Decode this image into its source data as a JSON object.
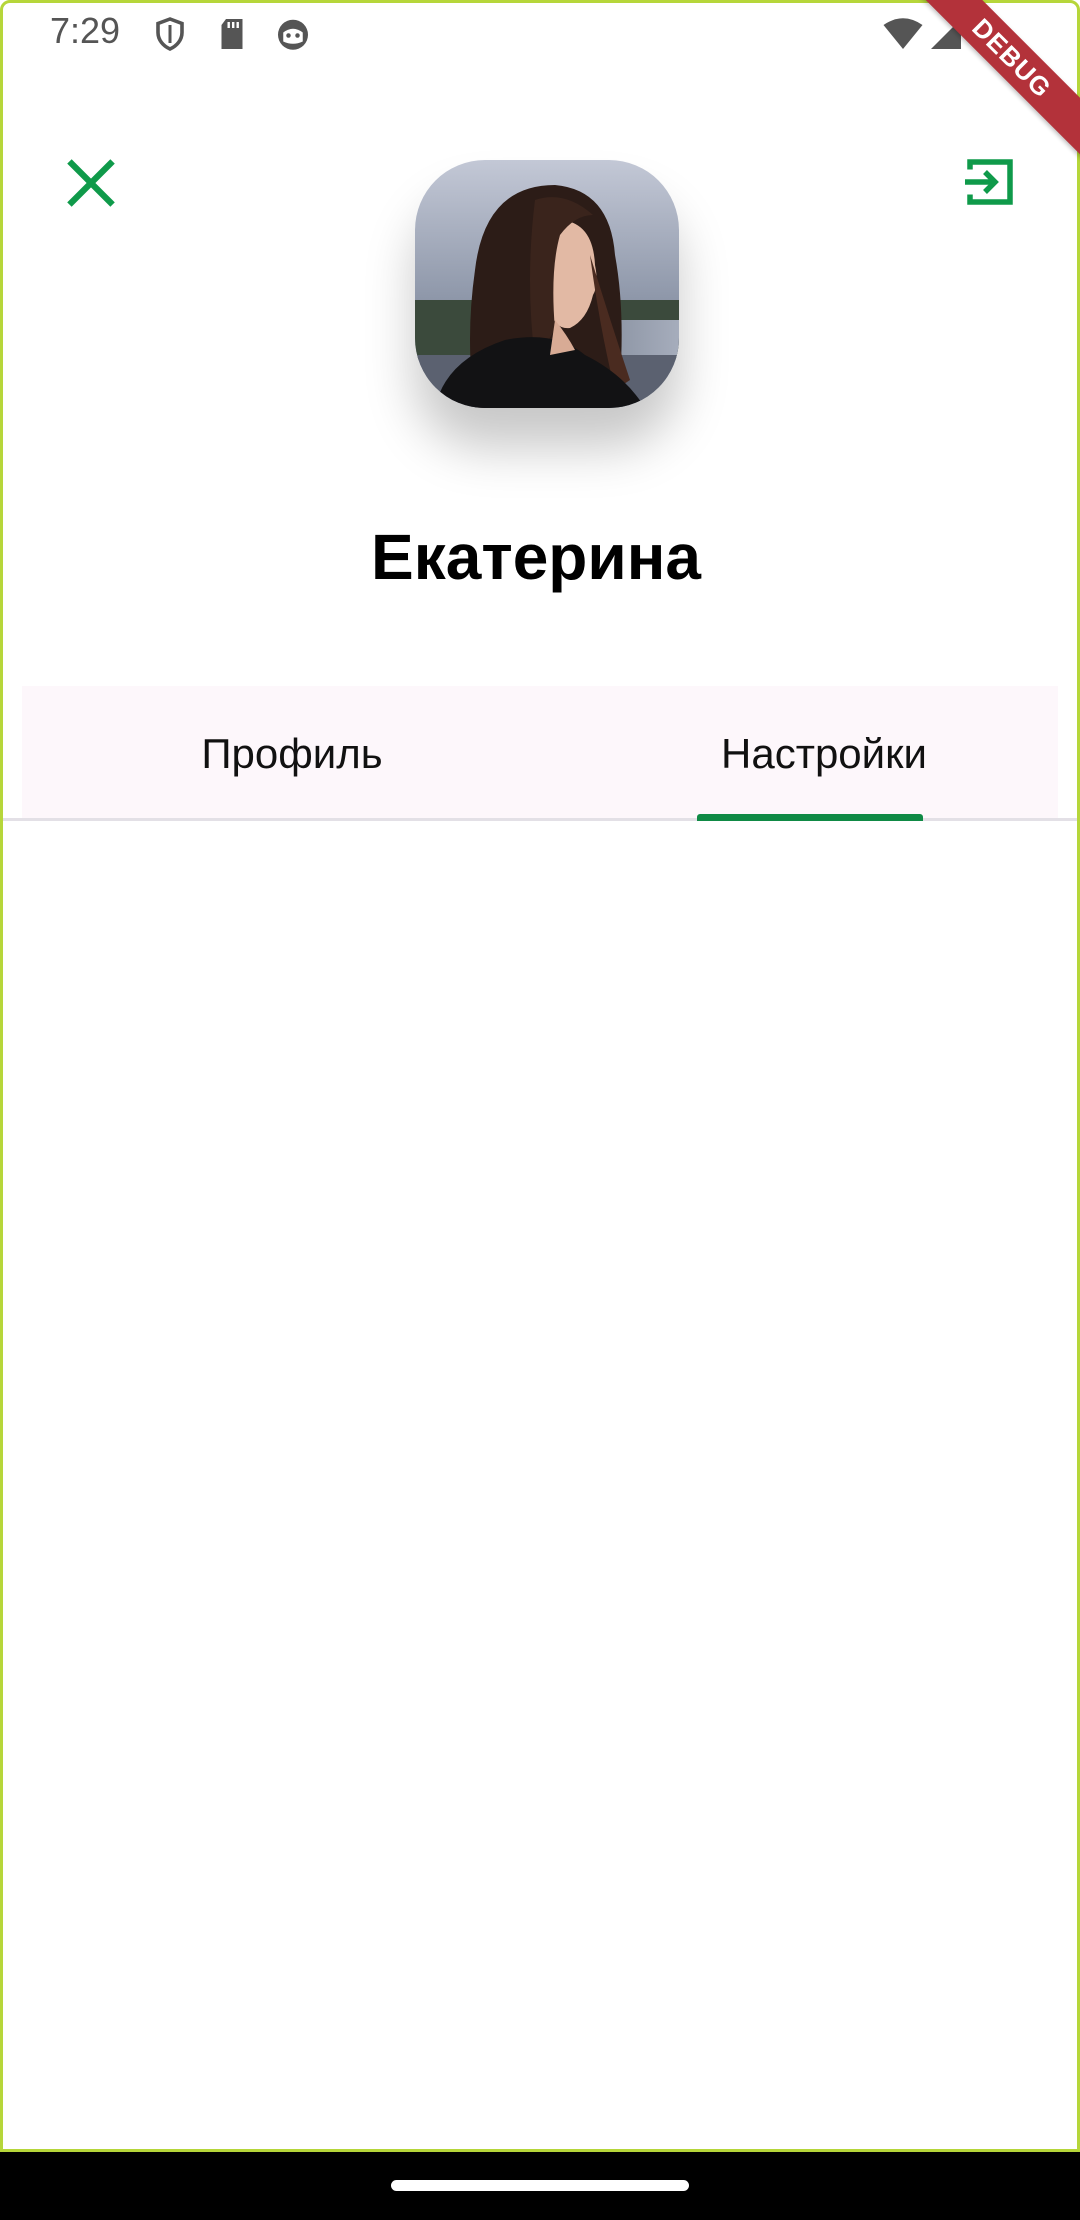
{
  "status_bar": {
    "time": "7:29",
    "icons": [
      "shield-icon",
      "sd-card-icon",
      "cat-face-icon",
      "wifi-icon",
      "signal-icon"
    ]
  },
  "debug_banner": "DEBUG",
  "header": {
    "close_icon": "close-icon",
    "logout_icon": "logout-icon",
    "name": "Екатерина"
  },
  "tabs": [
    {
      "label": "Профиль",
      "selected": false
    },
    {
      "label": "Настройки",
      "selected": true
    }
  ],
  "colors": {
    "accent": "#0f8a45",
    "tab_bar_bg": "#fdf7fb",
    "frame": "#b6d63a",
    "debug": "#b3323a"
  }
}
